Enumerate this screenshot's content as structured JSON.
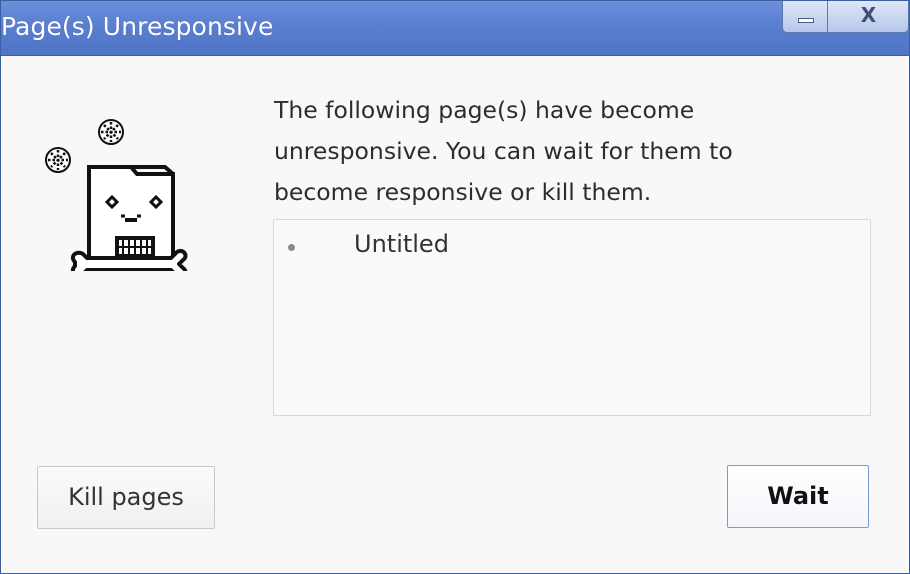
{
  "window": {
    "title": "Page(s) Unresponsive",
    "minimize_glyph": "",
    "close_glyph": "X"
  },
  "dialog": {
    "message": "The following page(s) have become\nunresponsive. You can wait for them to\nbecome responsive or kill them.",
    "pages": [
      {
        "label": "Untitled"
      }
    ]
  },
  "buttons": {
    "kill_label": "Kill pages",
    "wait_label": "Wait"
  },
  "icons": {
    "sad_page": "frozen-page-icon",
    "snowflake": "snowflake-icon",
    "minimize": "minimize-icon",
    "close": "close-icon"
  },
  "colors": {
    "titlebar": "#5a7ed0",
    "accent_border": "#7a9bd1",
    "background": "#f8f8f8"
  }
}
